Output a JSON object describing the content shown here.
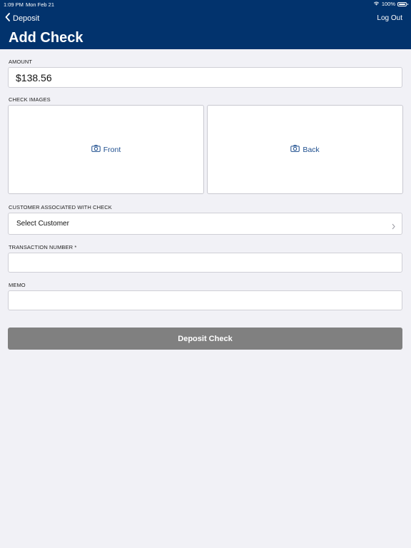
{
  "status_bar": {
    "time": "1:09 PM",
    "date": "Mon Feb 21",
    "battery": "100%"
  },
  "nav": {
    "back_label": "Deposit",
    "logout_label": "Log Out",
    "title": "Add Check"
  },
  "form": {
    "amount": {
      "label": "AMOUNT",
      "value": "$138.56"
    },
    "check_images": {
      "label": "CHECK IMAGES",
      "front_label": "Front",
      "back_label": "Back"
    },
    "customer": {
      "label": "CUSTOMER ASSOCIATED WITH CHECK",
      "value": "Select Customer"
    },
    "transaction_number": {
      "label": "TRANSACTION NUMBER *",
      "value": ""
    },
    "memo": {
      "label": "MEMO",
      "value": ""
    },
    "submit_label": "Deposit Check"
  },
  "colors": {
    "header": "#02336d",
    "background": "#f1f1f6",
    "button_disabled": "#808080",
    "link": "#1f4f8f"
  }
}
